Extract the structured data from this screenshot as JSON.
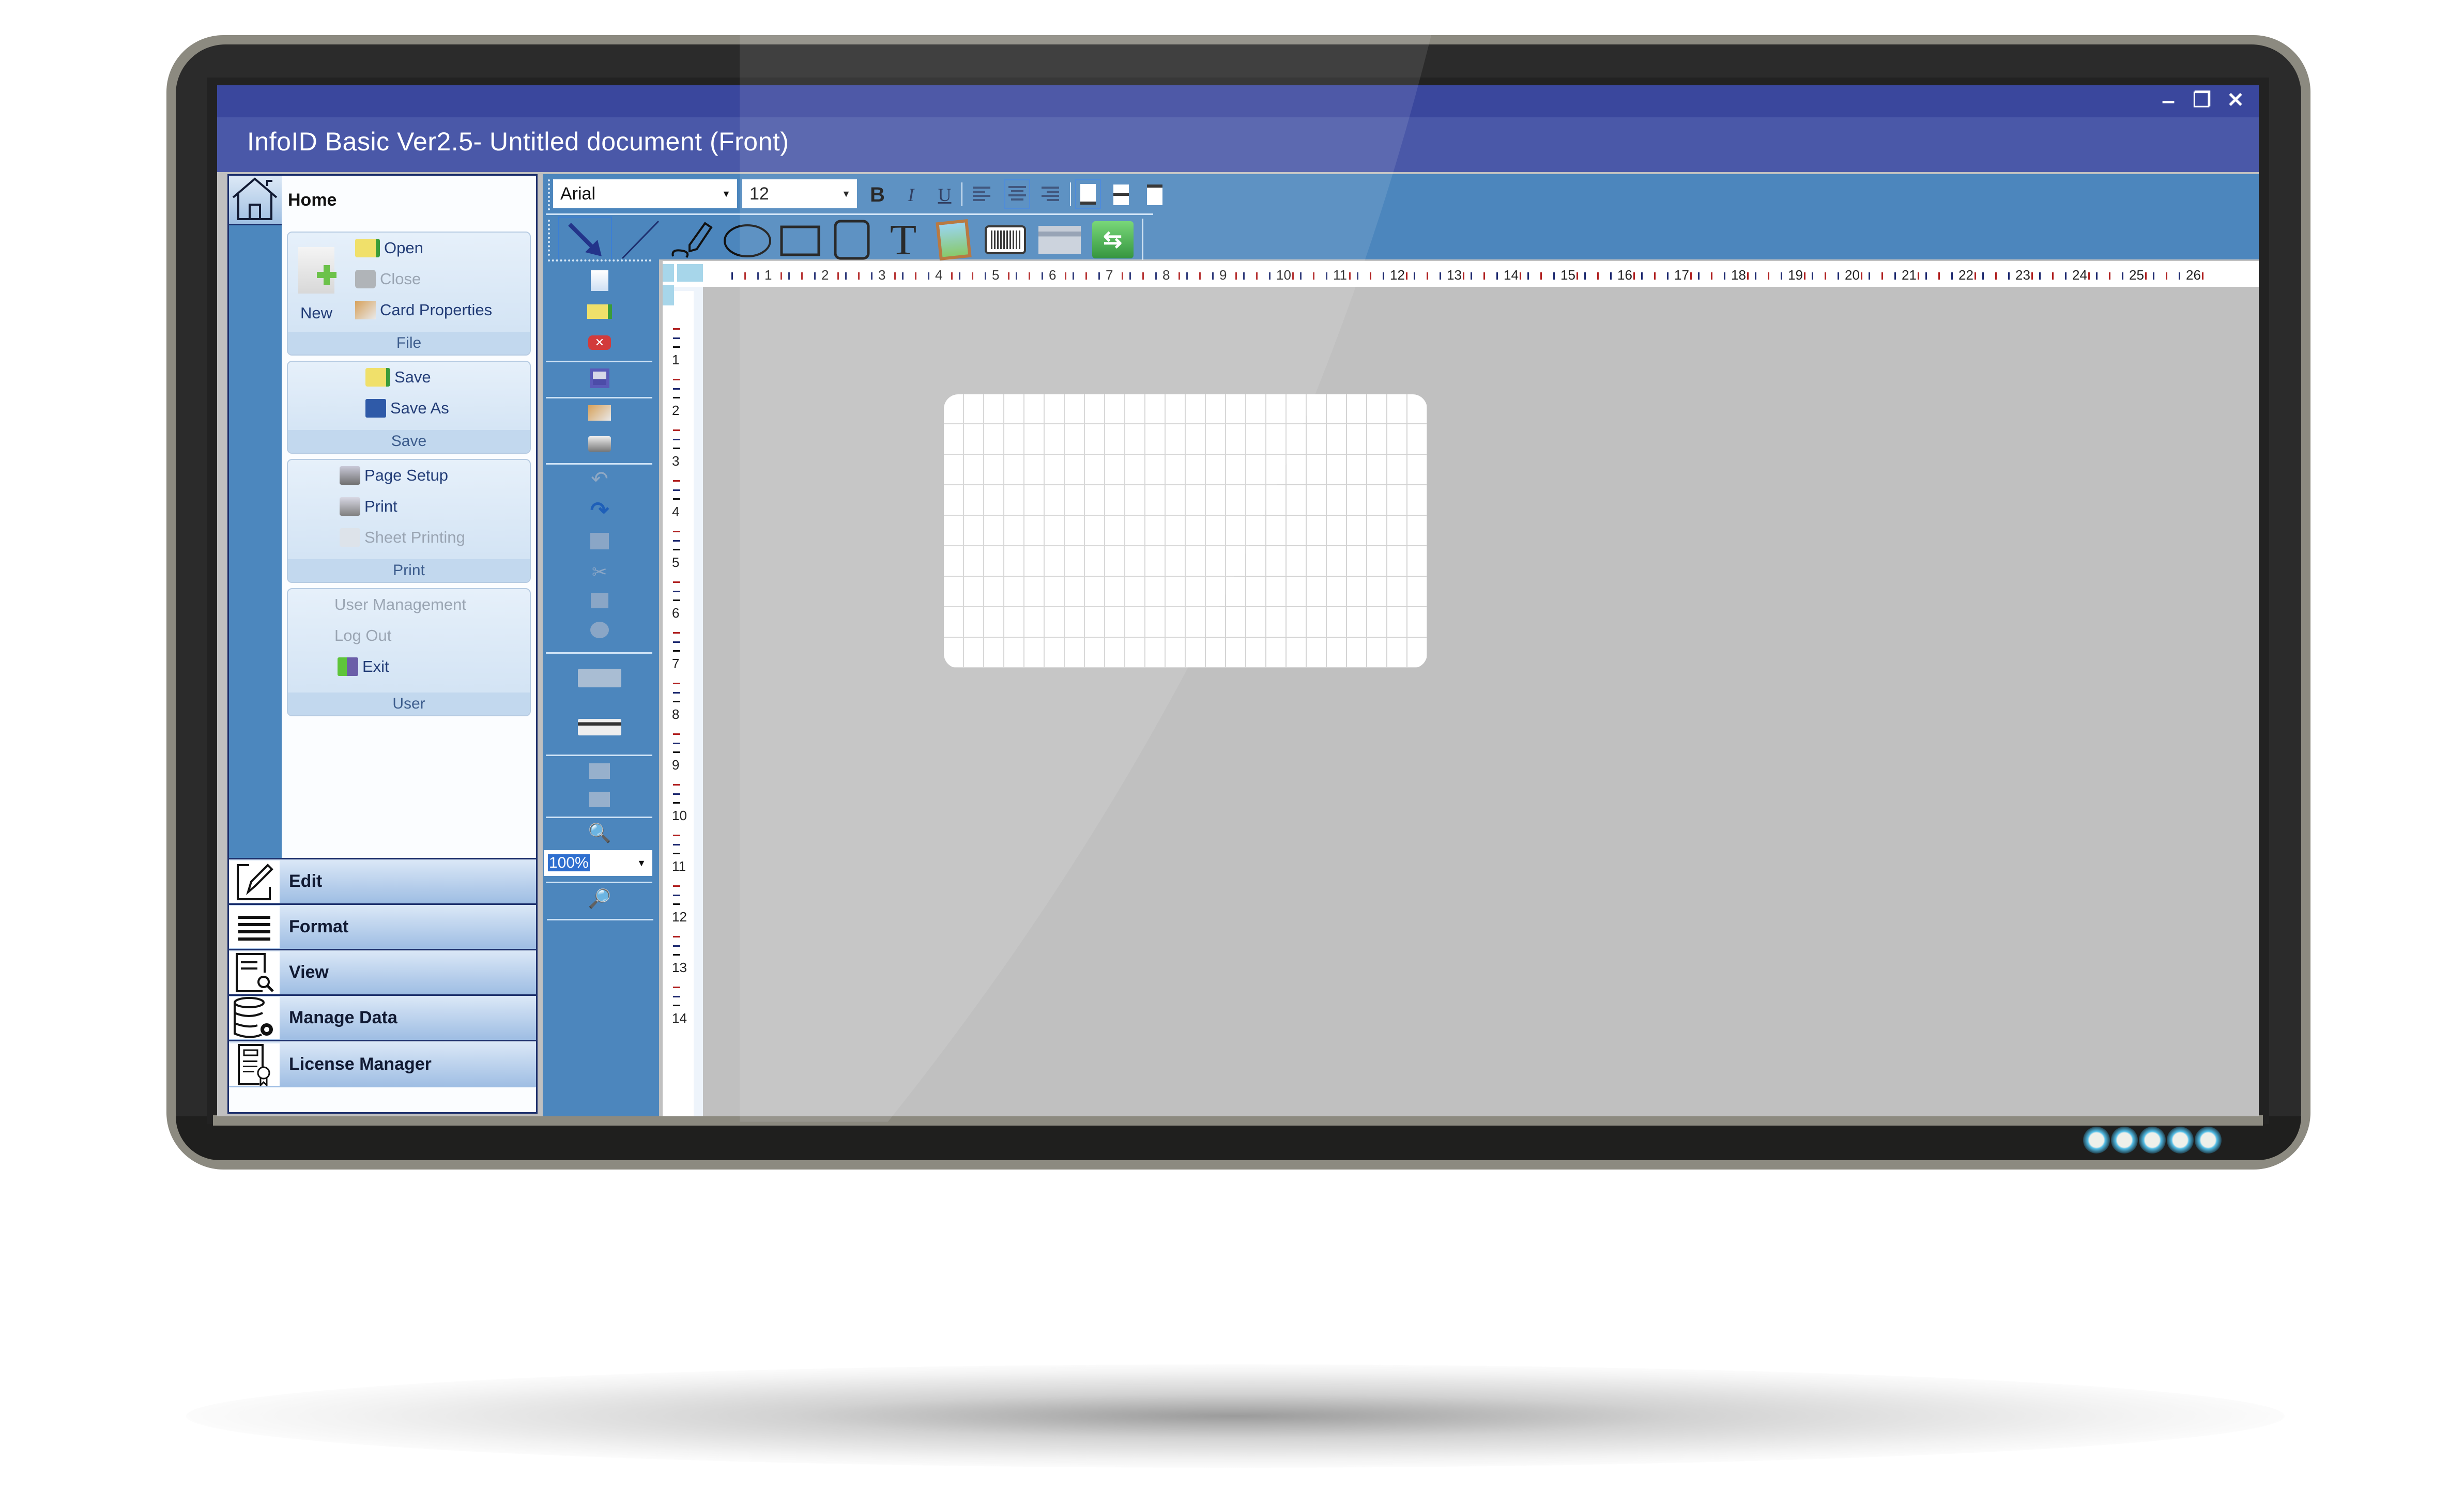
{
  "window": {
    "title": "InfoID Basic Ver2.5- Untitled document (Front)",
    "controls": {
      "minimize": "–",
      "restore": "❐",
      "close": "✕"
    }
  },
  "sidebar": {
    "home": {
      "label": "Home",
      "icon": "home-icon"
    },
    "groups": [
      {
        "label": "File",
        "large_item": {
          "label": "New",
          "icon": "new-document-icon"
        },
        "items": [
          {
            "label": "Open",
            "icon": "open-folder-icon",
            "enabled": true
          },
          {
            "label": "Close",
            "icon": "close-document-icon",
            "enabled": false
          },
          {
            "label": "Card Properties",
            "icon": "card-properties-icon",
            "enabled": true
          }
        ]
      },
      {
        "label": "Save",
        "items": [
          {
            "label": "Save",
            "icon": "save-folder-icon",
            "enabled": true
          },
          {
            "label": "Save As",
            "icon": "floppy-disk-icon",
            "enabled": true
          }
        ]
      },
      {
        "label": "Print",
        "items": [
          {
            "label": "Page Setup",
            "icon": "page-setup-icon",
            "enabled": true
          },
          {
            "label": "Print",
            "icon": "printer-icon",
            "enabled": true
          },
          {
            "label": "Sheet Printing",
            "icon": "sheet-printer-icon",
            "enabled": false
          }
        ]
      },
      {
        "label": "User",
        "items": [
          {
            "label": "User Management",
            "icon": "",
            "enabled": false
          },
          {
            "label": "Log Out",
            "icon": "",
            "enabled": false
          },
          {
            "label": "Exit",
            "icon": "exit-door-icon",
            "enabled": true
          }
        ]
      }
    ],
    "nav": [
      {
        "label": "Edit",
        "icon": "pencil-edit-icon"
      },
      {
        "label": "Format",
        "icon": "lines-format-icon"
      },
      {
        "label": "View",
        "icon": "document-search-icon"
      },
      {
        "label": "Manage Data",
        "icon": "database-gear-icon"
      },
      {
        "label": "License Manager",
        "icon": "certificate-icon"
      }
    ]
  },
  "format_toolbar": {
    "font": "Arial",
    "size": "12",
    "buttons": [
      "Bold",
      "Italic",
      "Underline",
      "Align Left",
      "Align Center",
      "Align Right",
      "Valign Bottom",
      "Valign Middle",
      "Valign Top"
    ],
    "bold_glyph": "B",
    "italic_glyph": "I",
    "underline_glyph": "U"
  },
  "draw_toolbar": {
    "tools": [
      "Select",
      "Line",
      "Freehand",
      "Ellipse",
      "Rectangle",
      "Rounded Rectangle",
      "Text",
      "Image",
      "Barcode",
      "Magnetic Stripe",
      "Switch Side"
    ],
    "text_glyph": "T"
  },
  "side_toolbar": {
    "zoom_value": "100%"
  },
  "ruler": {
    "horizontal": [
      "1",
      "2",
      "3",
      "4",
      "5",
      "6",
      "7",
      "8",
      "9",
      "10",
      "11",
      "12",
      "13",
      "14",
      "15",
      "16",
      "17",
      "18",
      "19",
      "20",
      "21",
      "22",
      "23",
      "24",
      "25",
      "26"
    ],
    "vertical": [
      "1",
      "2",
      "3",
      "4",
      "5",
      "6",
      "7",
      "8",
      "9",
      "10",
      "11",
      "12",
      "13",
      "14"
    ]
  },
  "colors": {
    "titlebar": "#4a58a8",
    "toolbar": "#4c86bd",
    "canvas": "#c0c0c0",
    "led": "#52bde6"
  },
  "monitor": {
    "leds": 5
  }
}
